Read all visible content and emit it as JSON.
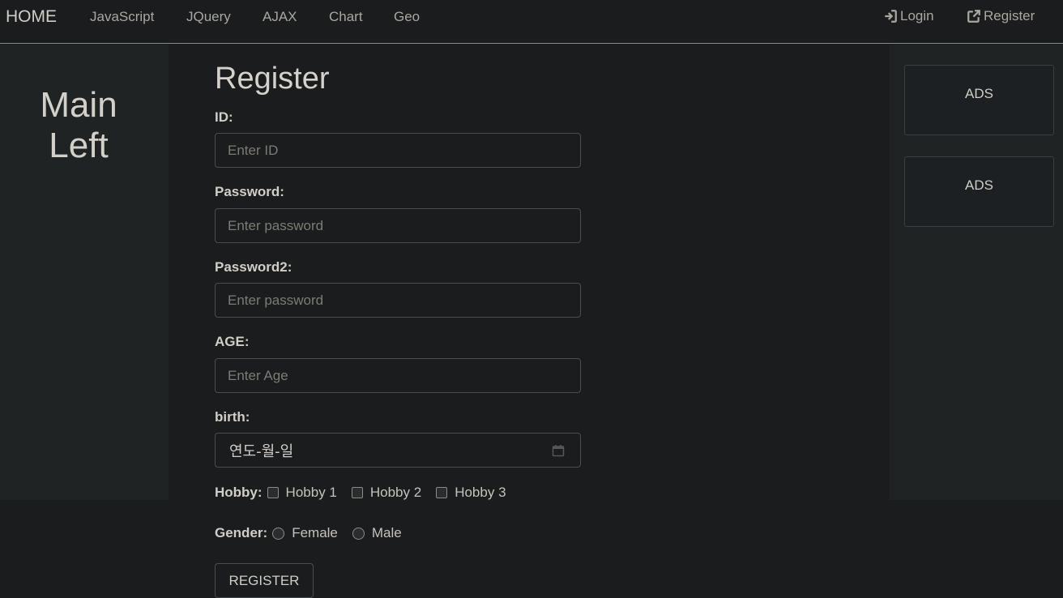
{
  "navbar": {
    "brand": "HOME",
    "links": [
      "JavaScript",
      "JQuery",
      "AJAX",
      "Chart",
      "Geo"
    ],
    "login": {
      "icon": "sign-in-icon",
      "label": "Login"
    },
    "register": {
      "icon": "external-link-icon",
      "label": "Register"
    }
  },
  "left": {
    "title_line1": "Main",
    "title_line2": "Left"
  },
  "right": {
    "ads": [
      "ADS",
      "ADS"
    ]
  },
  "form": {
    "title": "Register",
    "id": {
      "label": "ID:",
      "placeholder": "Enter ID"
    },
    "password": {
      "label": "Password:",
      "placeholder": "Enter password"
    },
    "password2": {
      "label": "Password2:",
      "placeholder": "Enter password"
    },
    "age": {
      "label": "AGE:",
      "placeholder": "Enter Age"
    },
    "birth": {
      "label": "birth:",
      "value": "연도-월-일",
      "icon": "calendar-icon"
    },
    "hobby": {
      "label": "Hobby:",
      "options": [
        "Hobby 1",
        "Hobby 2",
        "Hobby 3"
      ]
    },
    "gender": {
      "label": "Gender:",
      "options": [
        "Female",
        "Male"
      ]
    },
    "submit_label": "REGISTER"
  }
}
